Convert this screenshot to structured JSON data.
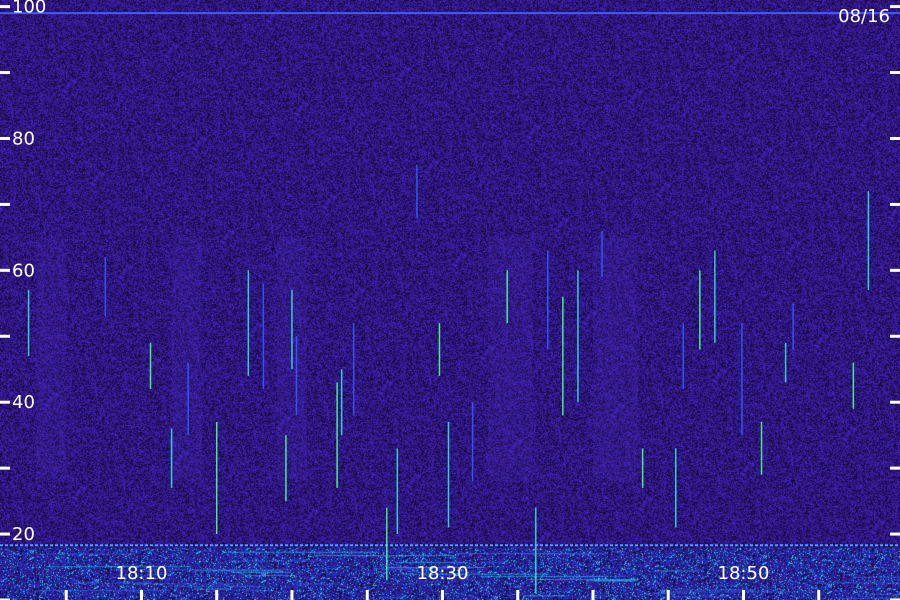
{
  "date_label": "08/16",
  "chart_data": {
    "type": "heatmap",
    "title": "",
    "xlabel": "",
    "ylabel": "",
    "ylim": [
      10,
      101
    ],
    "y_ticks_labeled": [
      20,
      40,
      60,
      80,
      100
    ],
    "y_ticks_minor": [
      10,
      30,
      50,
      70,
      90
    ],
    "x_tick_labels": [
      "18:10",
      "18:30",
      "18:50"
    ],
    "x_tick_minutes": [
      10,
      30,
      50
    ],
    "x_range_minutes": [
      0.6,
      60.4
    ],
    "x_major_tick_minutes": [
      5,
      10,
      15,
      20,
      25,
      30,
      35,
      40,
      45,
      50,
      55
    ],
    "colors": {
      "background_low": "#2a1368",
      "background_noise": "#3a1ea8",
      "dark_speck": "#120638",
      "line_blue": "#2f5cff",
      "line_cyan": "#36e0d8",
      "line_green": "#4cff8a",
      "bright_band": "#26d6ff",
      "axis": "#ffffff"
    },
    "horizontal_lines": [
      {
        "y": 99.0,
        "color": "#3f5cff"
      },
      {
        "y": 18.3,
        "color": "#3aa6ff"
      }
    ],
    "low_band": {
      "from": 10,
      "to": 18
    },
    "vertical_streaks": [
      {
        "x": 2.5,
        "y0": 47,
        "y1": 57
      },
      {
        "x": 7.6,
        "y0": 53,
        "y1": 62
      },
      {
        "x": 10.6,
        "y0": 42,
        "y1": 49
      },
      {
        "x": 12.0,
        "y0": 27,
        "y1": 36
      },
      {
        "x": 13.1,
        "y0": 35,
        "y1": 46
      },
      {
        "x": 15.0,
        "y0": 20,
        "y1": 37
      },
      {
        "x": 17.1,
        "y0": 44,
        "y1": 60
      },
      {
        "x": 18.1,
        "y0": 42,
        "y1": 58
      },
      {
        "x": 19.6,
        "y0": 25,
        "y1": 35
      },
      {
        "x": 20.0,
        "y0": 45,
        "y1": 57
      },
      {
        "x": 20.3,
        "y0": 38,
        "y1": 50
      },
      {
        "x": 23.0,
        "y0": 27,
        "y1": 43
      },
      {
        "x": 23.3,
        "y0": 35,
        "y1": 45
      },
      {
        "x": 24.1,
        "y0": 38,
        "y1": 52
      },
      {
        "x": 26.3,
        "y0": 13,
        "y1": 24
      },
      {
        "x": 27.0,
        "y0": 20,
        "y1": 33
      },
      {
        "x": 28.3,
        "y0": 68,
        "y1": 76
      },
      {
        "x": 29.8,
        "y0": 44,
        "y1": 52
      },
      {
        "x": 30.4,
        "y0": 21,
        "y1": 37
      },
      {
        "x": 32.0,
        "y0": 28,
        "y1": 40
      },
      {
        "x": 34.3,
        "y0": 52,
        "y1": 60
      },
      {
        "x": 36.2,
        "y0": 11,
        "y1": 24
      },
      {
        "x": 37.0,
        "y0": 48,
        "y1": 63
      },
      {
        "x": 38.0,
        "y0": 38,
        "y1": 56
      },
      {
        "x": 39.0,
        "y0": 40,
        "y1": 60
      },
      {
        "x": 40.6,
        "y0": 59,
        "y1": 66
      },
      {
        "x": 43.3,
        "y0": 27,
        "y1": 33
      },
      {
        "x": 45.5,
        "y0": 21,
        "y1": 33
      },
      {
        "x": 46.0,
        "y0": 42,
        "y1": 52
      },
      {
        "x": 47.1,
        "y0": 48,
        "y1": 60
      },
      {
        "x": 48.1,
        "y0": 49,
        "y1": 63
      },
      {
        "x": 49.9,
        "y0": 35,
        "y1": 52
      },
      {
        "x": 51.2,
        "y0": 29,
        "y1": 37
      },
      {
        "x": 52.8,
        "y0": 43,
        "y1": 49
      },
      {
        "x": 53.3,
        "y0": 48,
        "y1": 55
      },
      {
        "x": 57.3,
        "y0": 39,
        "y1": 46
      },
      {
        "x": 58.3,
        "y0": 57,
        "y1": 72
      }
    ]
  }
}
